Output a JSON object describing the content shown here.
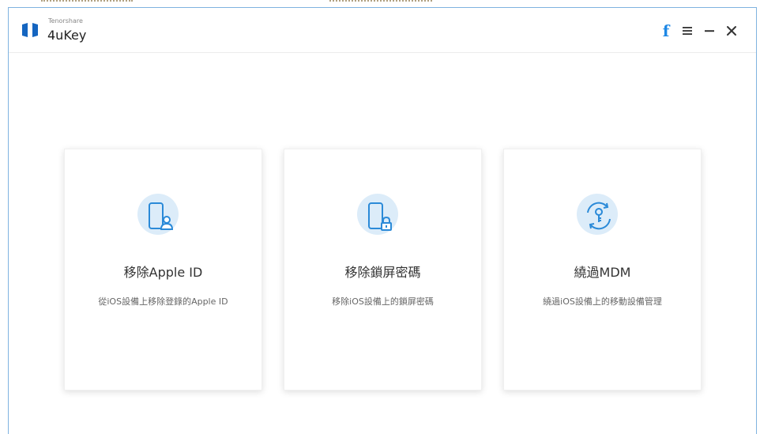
{
  "app": {
    "vendor": "Tenorshare",
    "name": "4uKey"
  },
  "titlebar": {
    "facebook_label": "f",
    "icons": [
      "facebook-icon",
      "menu-icon",
      "minimize-icon",
      "close-icon"
    ]
  },
  "cards": [
    {
      "title": "移除Apple ID",
      "description": "從iOS設備上移除登錄的Apple ID",
      "icon": "phone-user-icon"
    },
    {
      "title": "移除鎖屏密碼",
      "description": "移除iOS設備上的鎖屏密碼",
      "icon": "phone-lock-icon"
    },
    {
      "title": "繞過MDM",
      "description": "繞過iOS設備上的移動設備管理",
      "icon": "key-cycle-icon"
    }
  ],
  "colors": {
    "accent": "#1e88e5",
    "icon_bg": "#dcecf9",
    "icon_stroke": "#2b8ad8",
    "window_border": "#7fb3e0"
  }
}
